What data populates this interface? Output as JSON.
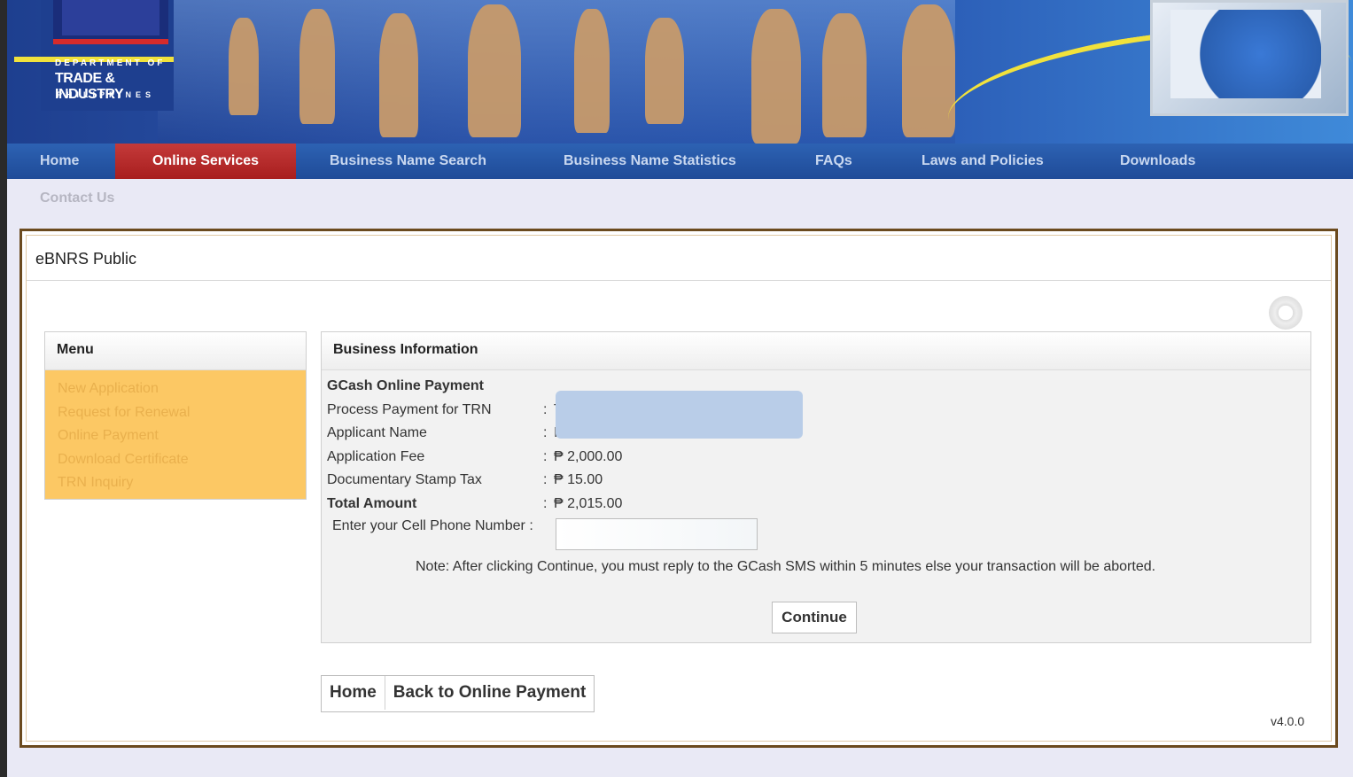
{
  "logo": {
    "dept": "DEPARTMENT OF",
    "trade": "TRADE & INDUSTRY",
    "country": "PHILIPPINES"
  },
  "nav": {
    "items": [
      "Home",
      "Online Services",
      "Business Name Search",
      "Business Name Statistics",
      "FAQs",
      "Laws and Policies",
      "Downloads"
    ],
    "active": "Online Services",
    "contact": "Contact Us"
  },
  "panel": {
    "title": "eBNRS Public"
  },
  "menu": {
    "header": "Menu",
    "items": [
      "New Application",
      "Request for Renewal",
      "Online Payment",
      "Download Certificate",
      "TRN Inquiry"
    ]
  },
  "business": {
    "header": "Business Information",
    "section_title": "GCash Online Payment",
    "trn_label": "Process Payment for TRN",
    "trn_value": "T",
    "applicant_label": "Applicant Name",
    "applicant_value": "I",
    "fee_label": "Application Fee",
    "fee_value": "₱  2,000.00",
    "stamp_label": "Documentary Stamp Tax",
    "stamp_value": "₱  15.00",
    "total_label": "Total Amount",
    "total_value": "₱  2,015.00",
    "phone_label": "Enter your Cell Phone Number :",
    "phone_value": "",
    "note": "Note: After clicking Continue, you must reply to the GCash SMS within 5 minutes else your transaction will be aborted.",
    "continue_label": "Continue"
  },
  "footer": {
    "home_label": "Home",
    "back_label": "Back to Online Payment",
    "version": "v4.0.0"
  }
}
